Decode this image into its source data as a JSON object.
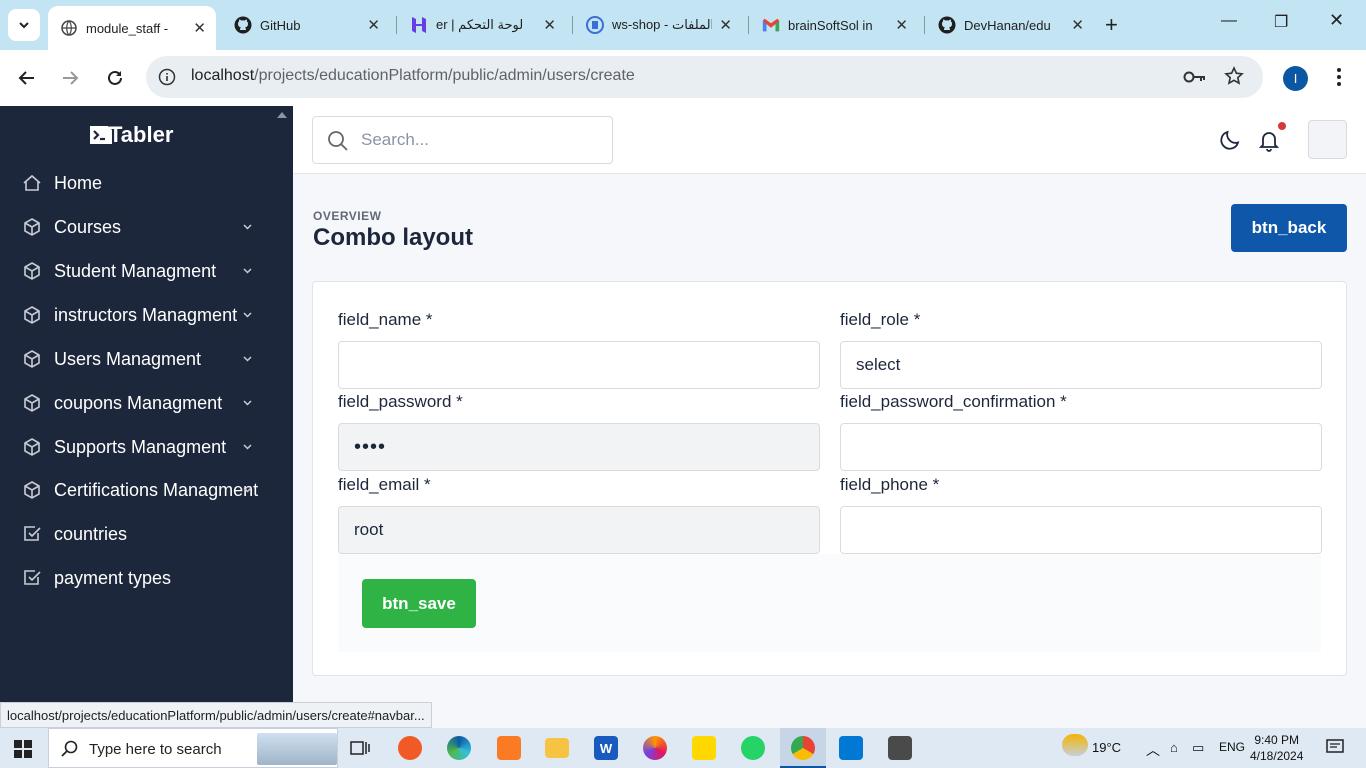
{
  "browser": {
    "tabs": [
      {
        "title": "module_staff -",
        "active": true
      },
      {
        "title": "GitHub"
      },
      {
        "title": "er | لوحة التحكم"
      },
      {
        "title": "ws-shop - الملفات"
      },
      {
        "title": "brainSoftSol in"
      },
      {
        "title": "DevHanan/edu"
      }
    ],
    "url_host": "localhost",
    "url_path": "/projects/educationPlatform/public/admin/users/create",
    "profile_initial": "I"
  },
  "sidebar": {
    "brand": "Tabler",
    "items": [
      {
        "label": "Home",
        "icon": "home-icon"
      },
      {
        "label": "Courses",
        "icon": "package-icon"
      },
      {
        "label": "Student Managment",
        "icon": "package-icon"
      },
      {
        "label": "instructors Managment",
        "icon": "package-icon"
      },
      {
        "label": "Users Managment",
        "icon": "package-icon"
      },
      {
        "label": "coupons Managment",
        "icon": "package-icon"
      },
      {
        "label": "Supports Managment",
        "icon": "package-icon"
      },
      {
        "label": "Certifications Managment",
        "icon": "package-icon"
      },
      {
        "label": "countries",
        "icon": "checkbox-icon"
      },
      {
        "label": "payment types",
        "icon": "checkbox-icon"
      }
    ]
  },
  "header": {
    "search_placeholder": "Search..."
  },
  "page": {
    "pretitle": "OVERVIEW",
    "title": "Combo layout",
    "back_label": "btn_back",
    "save_label": "btn_save"
  },
  "form": {
    "name_label": "field_name *",
    "role_label": "field_role *",
    "role_value": "select",
    "password_label": "field_password *",
    "password_value": "••••",
    "password_confirm_label": "field_password_confirmation *",
    "email_label": "field_email *",
    "email_value": "root",
    "phone_label": "field_phone *"
  },
  "status_url": "localhost/projects/educationPlatform/public/admin/users/create#navbar...",
  "taskbar": {
    "search_text": "Type here to search",
    "weather": "19°C",
    "lang": "ENG",
    "time": "9:40 PM",
    "date": "4/18/2024"
  },
  "colors": {
    "sidebar_bg": "#1d273b",
    "primary": "#0f57a8",
    "success": "#2fb344"
  }
}
